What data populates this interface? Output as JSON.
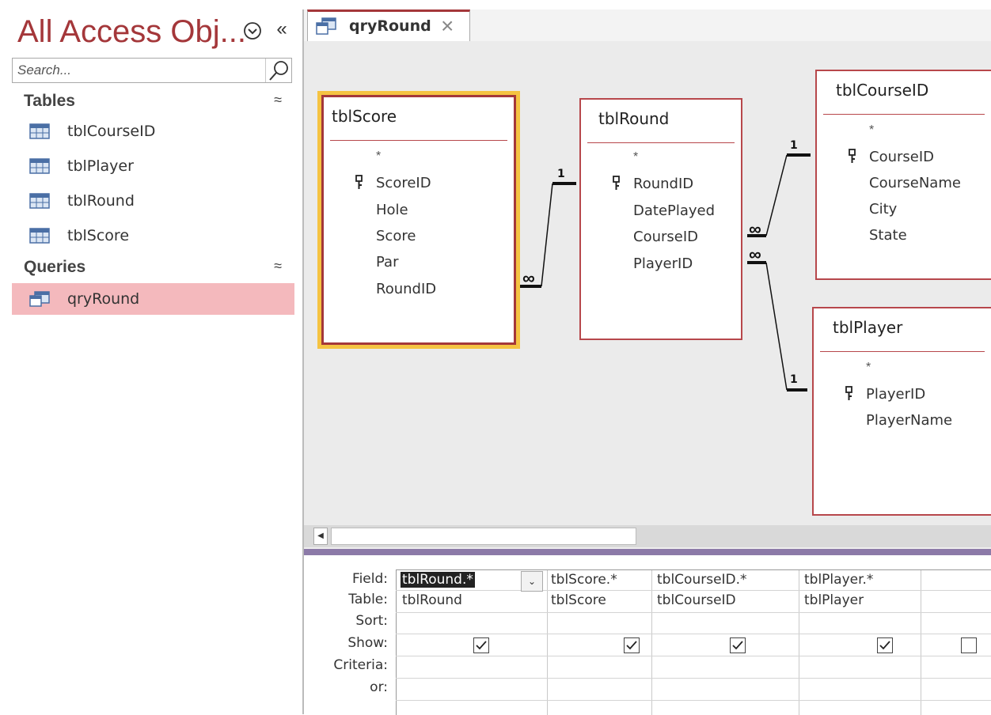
{
  "nav": {
    "title": "All Access Obj...",
    "menu_icon": "circle-chevron-down-icon",
    "collapse_icon": "double-chevron-left-icon",
    "search_placeholder": "Search...",
    "groups": [
      {
        "label": "Tables",
        "items": [
          "tblCourseID",
          "tblPlayer",
          "tblRound",
          "tblScore"
        ]
      },
      {
        "label": "Queries",
        "items": [
          "qryRound"
        ]
      }
    ],
    "selected_item": "qryRound"
  },
  "tab": {
    "label": "qryRound"
  },
  "tables": {
    "score": {
      "name": "tblScore",
      "star": "*",
      "fields": [
        "ScoreID",
        "Hole",
        "Score",
        "Par",
        "RoundID"
      ]
    },
    "round": {
      "name": "tblRound",
      "star": "*",
      "fields": [
        "RoundID",
        "DatePlayed",
        "CourseID",
        "PlayerID"
      ]
    },
    "course": {
      "name": "tblCourseID",
      "star": "*",
      "fields": [
        "CourseID",
        "CourseName",
        "City",
        "State"
      ]
    },
    "player": {
      "name": "tblPlayer",
      "star": "*",
      "fields": [
        "PlayerID",
        "PlayerName"
      ]
    }
  },
  "relationships": {
    "one": "1",
    "many": "∞"
  },
  "qbe": {
    "row_labels": [
      "Field:",
      "Table:",
      "Sort:",
      "Show:",
      "Criteria:",
      "or:"
    ],
    "columns": [
      {
        "field": "tblRound.*",
        "table": "tblRound",
        "show": true
      },
      {
        "field": "tblScore.*",
        "table": "tblScore",
        "show": true
      },
      {
        "field": "tblCourseID.*",
        "table": "tblCourseID",
        "show": true
      },
      {
        "field": "tblPlayer.*",
        "table": "tblPlayer",
        "show": true
      },
      {
        "field": "",
        "table": "",
        "show": false
      }
    ]
  },
  "colors": {
    "accent": "#a4373a",
    "selected_nav": "#f4b9bd",
    "selected_table_outline": "#f5c342"
  }
}
